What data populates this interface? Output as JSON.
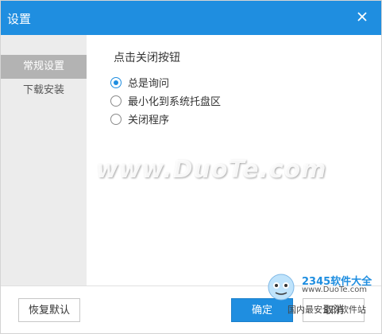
{
  "window": {
    "title": "设置"
  },
  "sidebar": {
    "items": [
      {
        "label": "常规设置",
        "active": true
      },
      {
        "label": "下载安装",
        "active": false
      }
    ]
  },
  "close_behavior": {
    "title": "点击关闭按钮",
    "options": [
      {
        "label": "总是询问",
        "checked": true
      },
      {
        "label": "最小化到系统托盘区",
        "checked": false
      },
      {
        "label": "关闭程序",
        "checked": false
      }
    ]
  },
  "footer": {
    "restore_label": "恢复默认",
    "ok_label": "确定",
    "cancel_label": "取消"
  },
  "watermark": {
    "text": "www.DuoTe.com"
  },
  "corner_logo": {
    "brand": "2345软件大全",
    "sub": "www.DuoTe.com",
    "site": "国内最安全的软件站"
  },
  "colors": {
    "accent": "#1f8ee0",
    "sidebar_bg": "#ececec",
    "sidebar_active": "#b3b3b3"
  }
}
